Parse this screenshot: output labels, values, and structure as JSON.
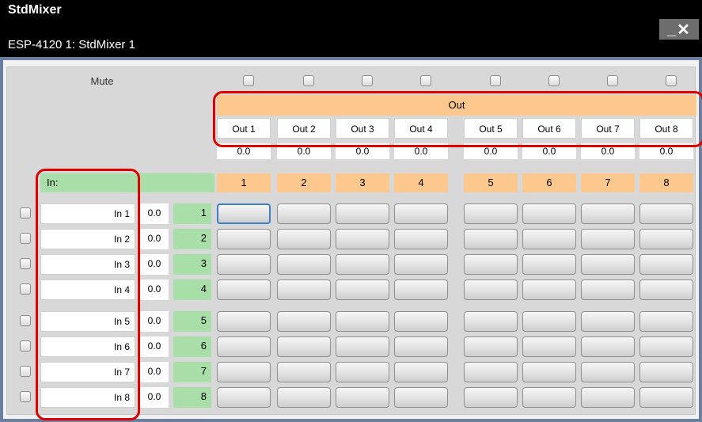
{
  "window": {
    "title": "StdMixer",
    "subtitle": "ESP-4120 1: StdMixer 1",
    "minimize_glyph": "_",
    "close_glyph": "✕"
  },
  "mute_label": "Mute",
  "out_label": "Out",
  "in_label": "In:",
  "outputs": [
    {
      "name": "Out 1",
      "gain": "0.0",
      "num": "1"
    },
    {
      "name": "Out 2",
      "gain": "0.0",
      "num": "2"
    },
    {
      "name": "Out 3",
      "gain": "0.0",
      "num": "3"
    },
    {
      "name": "Out 4",
      "gain": "0.0",
      "num": "4"
    },
    {
      "name": "Out 5",
      "gain": "0.0",
      "num": "5"
    },
    {
      "name": "Out 6",
      "gain": "0.0",
      "num": "6"
    },
    {
      "name": "Out 7",
      "gain": "0.0",
      "num": "7"
    },
    {
      "name": "Out 8",
      "gain": "0.0",
      "num": "8"
    }
  ],
  "inputs": [
    {
      "name": "In 1",
      "gain": "0.0",
      "num": "1"
    },
    {
      "name": "In 2",
      "gain": "0.0",
      "num": "2"
    },
    {
      "name": "In 3",
      "gain": "0.0",
      "num": "3"
    },
    {
      "name": "In 4",
      "gain": "0.0",
      "num": "4"
    },
    {
      "name": "In 5",
      "gain": "0.0",
      "num": "5"
    },
    {
      "name": "In 6",
      "gain": "0.0",
      "num": "6"
    },
    {
      "name": "In 7",
      "gain": "0.0",
      "num": "7"
    },
    {
      "name": "In 8",
      "gain": "0.0",
      "num": "8"
    }
  ],
  "colors": {
    "titlebar": "#000000",
    "out_accent": "#fcc88e",
    "in_accent": "#a8dfa8",
    "highlight": "#e00000",
    "selected_border": "#3c7fc6"
  },
  "selected_crosspoint": {
    "input": "1",
    "output": "1"
  }
}
